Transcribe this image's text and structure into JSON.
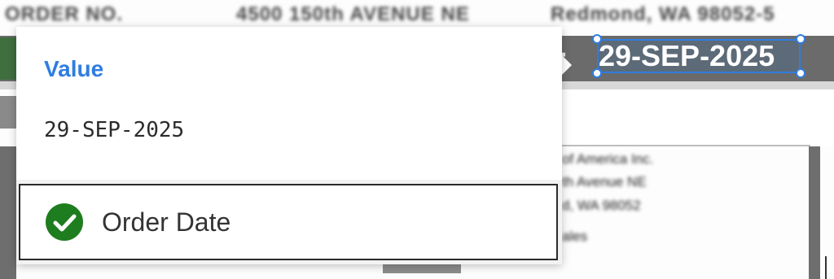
{
  "background": {
    "top_text": [
      "ORDER NO.",
      "4500 150th AVENUE NE",
      "Redmond, WA 98052-5"
    ],
    "address_lines": [
      "of America Inc.",
      "th Avenue NE",
      "d, WA 98052",
      "ales"
    ]
  },
  "field": {
    "prefix": ":",
    "value_display": "29-SEP-2025"
  },
  "popup": {
    "value_label": "Value",
    "value_text": "29-SEP-2025",
    "field_name": "Order Date",
    "check_icon": "check-circle-icon"
  },
  "colors": {
    "accent": "#2f7de1",
    "success": "#1e7d1e"
  }
}
